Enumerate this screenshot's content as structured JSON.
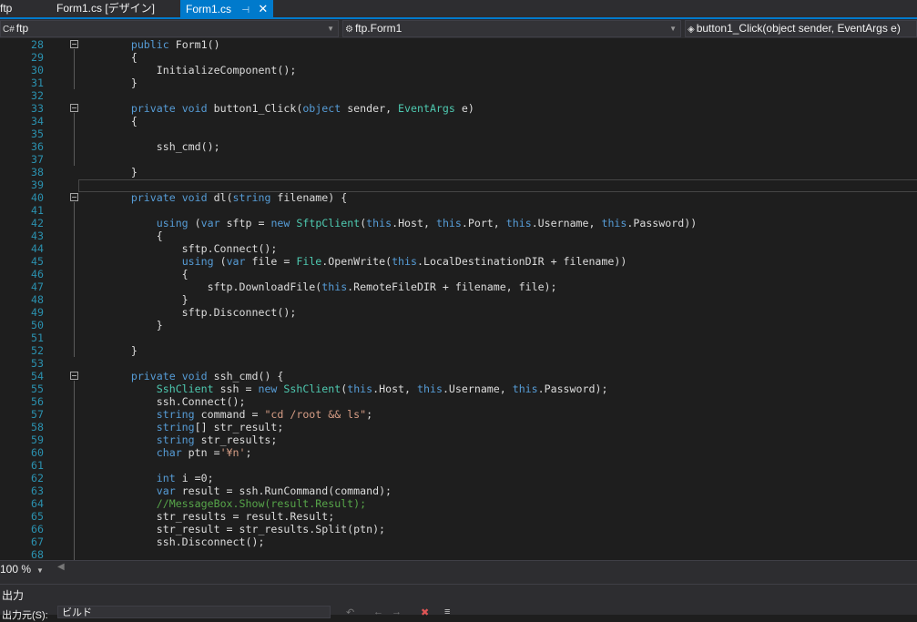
{
  "tabs": [
    {
      "label": "ftp"
    },
    {
      "label": "Form1.cs [デザイン]"
    },
    {
      "label": "Form1.cs",
      "active": true
    }
  ],
  "tab_pin_icon": "pin-icon",
  "tab_close_icon": "close-icon",
  "nav": {
    "project": "ftp",
    "class": "ftp.Form1",
    "member": "button1_Click(object sender, EventArgs e)"
  },
  "code_lines": [
    {
      "n": "28",
      "fold": true,
      "tokens": [
        {
          "t": "        "
        },
        {
          "t": "public",
          "c": "k"
        },
        {
          "t": " Form1()"
        }
      ]
    },
    {
      "n": "29",
      "tokens": [
        {
          "t": "        {"
        }
      ]
    },
    {
      "n": "30",
      "tokens": [
        {
          "t": "            InitializeComponent();"
        }
      ]
    },
    {
      "n": "31",
      "tokens": [
        {
          "t": "        }"
        }
      ]
    },
    {
      "n": "32",
      "tokens": [
        {
          "t": ""
        }
      ]
    },
    {
      "n": "33",
      "fold": true,
      "tokens": [
        {
          "t": "        "
        },
        {
          "t": "private",
          "c": "k"
        },
        {
          "t": " "
        },
        {
          "t": "void",
          "c": "k"
        },
        {
          "t": " button1_Click("
        },
        {
          "t": "object",
          "c": "k"
        },
        {
          "t": " sender, "
        },
        {
          "t": "EventArgs",
          "c": "t"
        },
        {
          "t": " e)"
        }
      ]
    },
    {
      "n": "34",
      "tokens": [
        {
          "t": "        {"
        }
      ]
    },
    {
      "n": "35",
      "tokens": [
        {
          "t": ""
        }
      ]
    },
    {
      "n": "36",
      "tokens": [
        {
          "t": "            ssh_cmd();"
        }
      ]
    },
    {
      "n": "37",
      "tokens": [
        {
          "t": ""
        }
      ]
    },
    {
      "n": "38",
      "tokens": [
        {
          "t": "        }"
        }
      ]
    },
    {
      "n": "39",
      "tokens": [
        {
          "t": ""
        }
      ]
    },
    {
      "n": "40",
      "fold": true,
      "tokens": [
        {
          "t": "        "
        },
        {
          "t": "private",
          "c": "k"
        },
        {
          "t": " "
        },
        {
          "t": "void",
          "c": "k"
        },
        {
          "t": " dl("
        },
        {
          "t": "string",
          "c": "k"
        },
        {
          "t": " filename) {"
        }
      ]
    },
    {
      "n": "41",
      "tokens": [
        {
          "t": ""
        }
      ]
    },
    {
      "n": "42",
      "tokens": [
        {
          "t": "            "
        },
        {
          "t": "using",
          "c": "k"
        },
        {
          "t": " ("
        },
        {
          "t": "var",
          "c": "k"
        },
        {
          "t": " sftp = "
        },
        {
          "t": "new",
          "c": "k"
        },
        {
          "t": " "
        },
        {
          "t": "SftpClient",
          "c": "t"
        },
        {
          "t": "("
        },
        {
          "t": "this",
          "c": "k"
        },
        {
          "t": ".Host, "
        },
        {
          "t": "this",
          "c": "k"
        },
        {
          "t": ".Port, "
        },
        {
          "t": "this",
          "c": "k"
        },
        {
          "t": ".Username, "
        },
        {
          "t": "this",
          "c": "k"
        },
        {
          "t": ".Password))"
        }
      ]
    },
    {
      "n": "43",
      "tokens": [
        {
          "t": "            {"
        }
      ]
    },
    {
      "n": "44",
      "tokens": [
        {
          "t": "                sftp.Connect();"
        }
      ]
    },
    {
      "n": "45",
      "tokens": [
        {
          "t": "                "
        },
        {
          "t": "using",
          "c": "k"
        },
        {
          "t": " ("
        },
        {
          "t": "var",
          "c": "k"
        },
        {
          "t": " file = "
        },
        {
          "t": "File",
          "c": "t"
        },
        {
          "t": ".OpenWrite("
        },
        {
          "t": "this",
          "c": "k"
        },
        {
          "t": ".LocalDestinationDIR + filename))"
        }
      ]
    },
    {
      "n": "46",
      "tokens": [
        {
          "t": "                {"
        }
      ]
    },
    {
      "n": "47",
      "tokens": [
        {
          "t": "                    sftp.DownloadFile("
        },
        {
          "t": "this",
          "c": "k"
        },
        {
          "t": ".RemoteFileDIR + filename, file);"
        }
      ]
    },
    {
      "n": "48",
      "tokens": [
        {
          "t": "                }"
        }
      ]
    },
    {
      "n": "49",
      "tokens": [
        {
          "t": "                sftp.Disconnect();"
        }
      ]
    },
    {
      "n": "50",
      "tokens": [
        {
          "t": "            }"
        }
      ]
    },
    {
      "n": "51",
      "tokens": [
        {
          "t": ""
        }
      ]
    },
    {
      "n": "52",
      "tokens": [
        {
          "t": "        }"
        }
      ]
    },
    {
      "n": "53",
      "tokens": [
        {
          "t": ""
        }
      ]
    },
    {
      "n": "54",
      "fold": true,
      "tokens": [
        {
          "t": "        "
        },
        {
          "t": "private",
          "c": "k"
        },
        {
          "t": " "
        },
        {
          "t": "void",
          "c": "k"
        },
        {
          "t": " ssh_cmd() {"
        }
      ]
    },
    {
      "n": "55",
      "tokens": [
        {
          "t": "            "
        },
        {
          "t": "SshClient",
          "c": "t"
        },
        {
          "t": " ssh = "
        },
        {
          "t": "new",
          "c": "k"
        },
        {
          "t": " "
        },
        {
          "t": "SshClient",
          "c": "t"
        },
        {
          "t": "("
        },
        {
          "t": "this",
          "c": "k"
        },
        {
          "t": ".Host, "
        },
        {
          "t": "this",
          "c": "k"
        },
        {
          "t": ".Username, "
        },
        {
          "t": "this",
          "c": "k"
        },
        {
          "t": ".Password);"
        }
      ]
    },
    {
      "n": "56",
      "tokens": [
        {
          "t": "            ssh.Connect();"
        }
      ]
    },
    {
      "n": "57",
      "tokens": [
        {
          "t": "            "
        },
        {
          "t": "string",
          "c": "k"
        },
        {
          "t": " command = "
        },
        {
          "t": "\"cd /root && ls\"",
          "c": "s"
        },
        {
          "t": ";"
        }
      ]
    },
    {
      "n": "58",
      "tokens": [
        {
          "t": "            "
        },
        {
          "t": "string",
          "c": "k"
        },
        {
          "t": "[] str_result;"
        }
      ]
    },
    {
      "n": "59",
      "tokens": [
        {
          "t": "            "
        },
        {
          "t": "string",
          "c": "k"
        },
        {
          "t": " str_results;"
        }
      ]
    },
    {
      "n": "60",
      "tokens": [
        {
          "t": "            "
        },
        {
          "t": "char",
          "c": "k"
        },
        {
          "t": " ptn ="
        },
        {
          "t": "'¥n'",
          "c": "s"
        },
        {
          "t": ";"
        }
      ]
    },
    {
      "n": "61",
      "tokens": [
        {
          "t": ""
        }
      ]
    },
    {
      "n": "62",
      "tokens": [
        {
          "t": "            "
        },
        {
          "t": "int",
          "c": "k"
        },
        {
          "t": " i =0;"
        }
      ]
    },
    {
      "n": "63",
      "tokens": [
        {
          "t": "            "
        },
        {
          "t": "var",
          "c": "k"
        },
        {
          "t": " result = ssh.RunCommand(command);"
        }
      ]
    },
    {
      "n": "64",
      "tokens": [
        {
          "t": "            "
        },
        {
          "t": "//MessageBox.Show(result.Result);",
          "c": "c"
        }
      ]
    },
    {
      "n": "65",
      "tokens": [
        {
          "t": "            str_results = result.Result;"
        }
      ]
    },
    {
      "n": "66",
      "tokens": [
        {
          "t": "            str_result = str_results.Split(ptn);"
        }
      ]
    },
    {
      "n": "67",
      "tokens": [
        {
          "t": "            ssh.Disconnect();"
        }
      ]
    },
    {
      "n": "68",
      "tokens": [
        {
          "t": ""
        }
      ]
    }
  ],
  "zoom": "100 %",
  "output": {
    "title": "出力",
    "source_label": "出力元(S):",
    "source_value": "ビルド"
  },
  "colors": {
    "accent": "#007acc",
    "keyword": "#569cd6",
    "type": "#4ec9b0",
    "string": "#d69d85",
    "comment": "#57a64a",
    "line_number": "#2b91af"
  }
}
